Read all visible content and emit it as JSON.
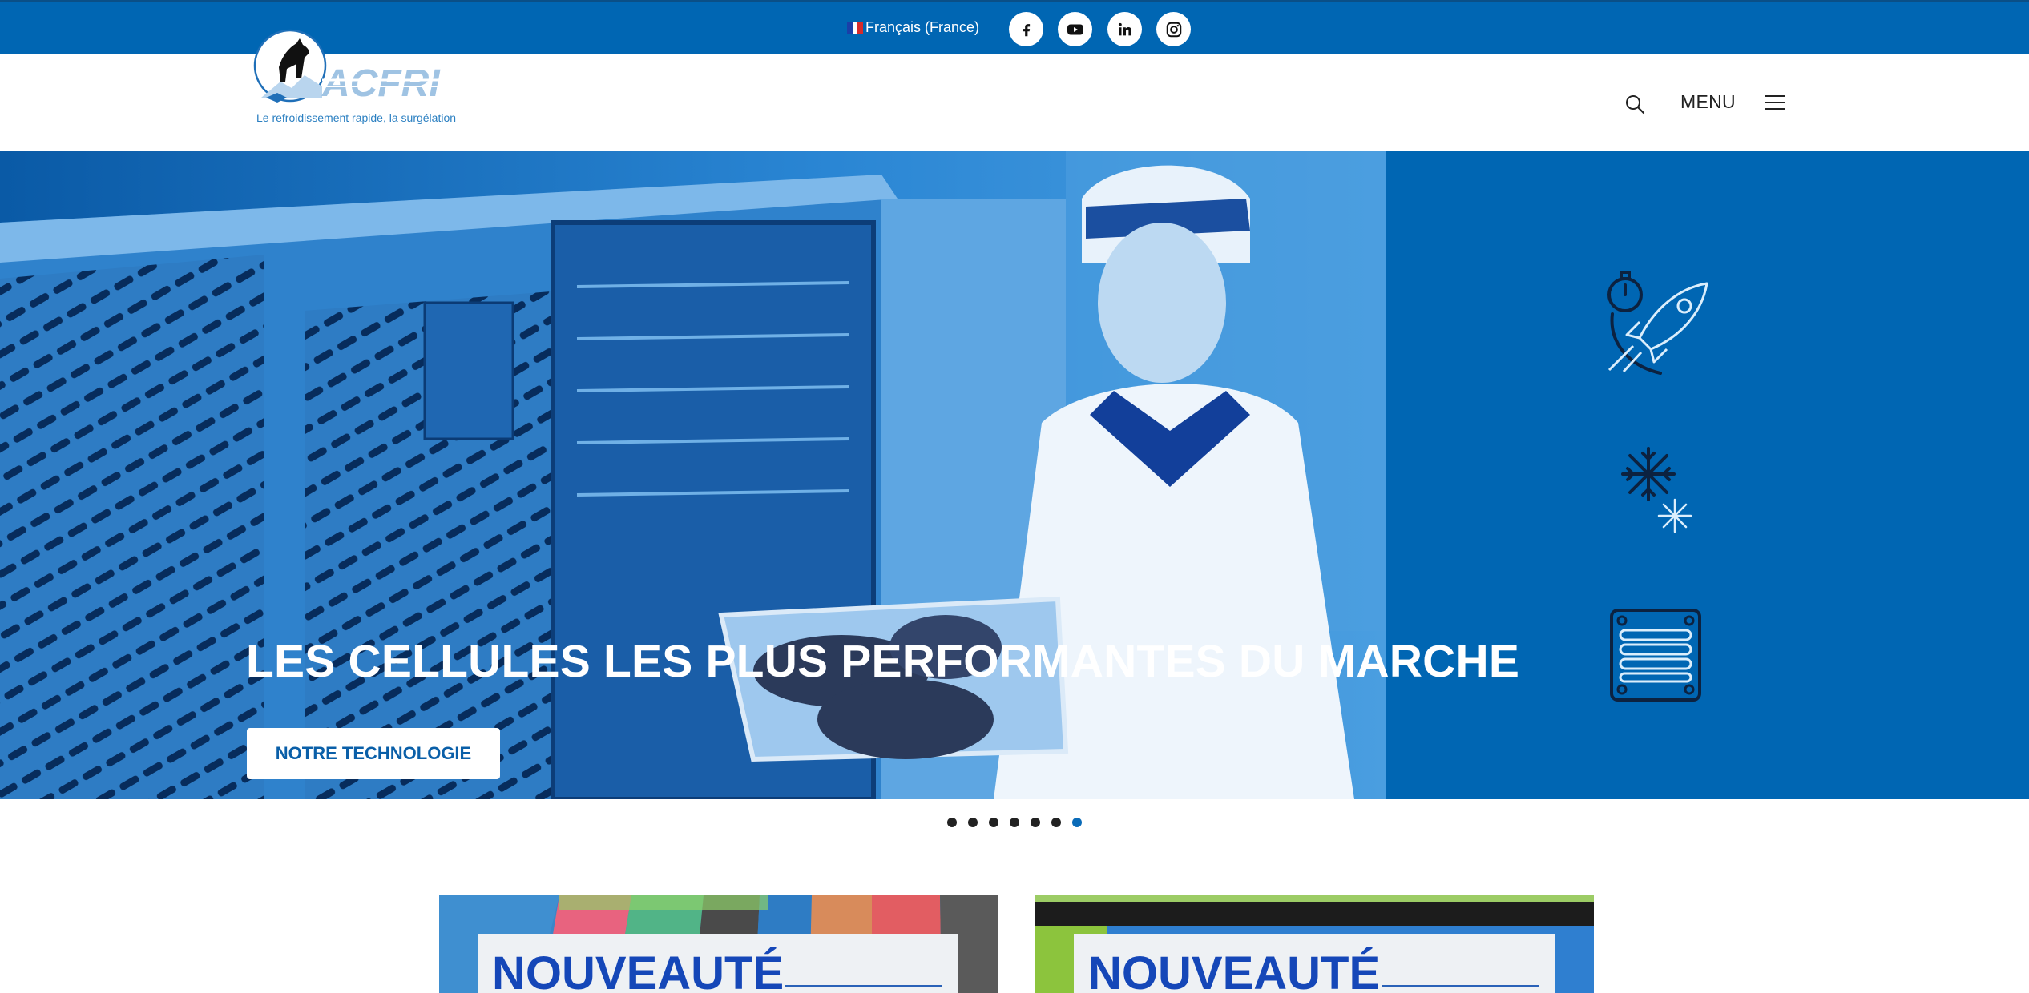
{
  "topbar": {
    "language_label": "Français (France)",
    "social": [
      {
        "icon": "facebook-icon"
      },
      {
        "icon": "youtube-icon"
      },
      {
        "icon": "linkedin-icon"
      },
      {
        "icon": "instagram-icon"
      }
    ]
  },
  "header": {
    "logo_text": "ACFRI",
    "logo_tagline": "Le refroidissement rapide, la surgélation",
    "search_icon": "search-icon",
    "menu_label": "MENU",
    "menu_icon": "hamburger-icon"
  },
  "hero": {
    "title": "LES CELLULES LES PLUS PERFORMANTES DU MARCHE",
    "button_label": "NOTRE TECHNOLOGIE",
    "feature_icons": [
      "rocket-stopwatch-icon",
      "snowflake-icon",
      "ventilation-grille-icon"
    ],
    "slides_total": 7,
    "active_slide": 7
  },
  "cards": [
    {
      "badge": "NOUVEAUTÉ"
    },
    {
      "badge": "NOUVEAUTÉ"
    }
  ],
  "colors": {
    "brand_blue": "#0066b3",
    "button_text": "#0a5fa8",
    "card_title": "#1547b8",
    "active_dot": "#0a6bb8"
  }
}
